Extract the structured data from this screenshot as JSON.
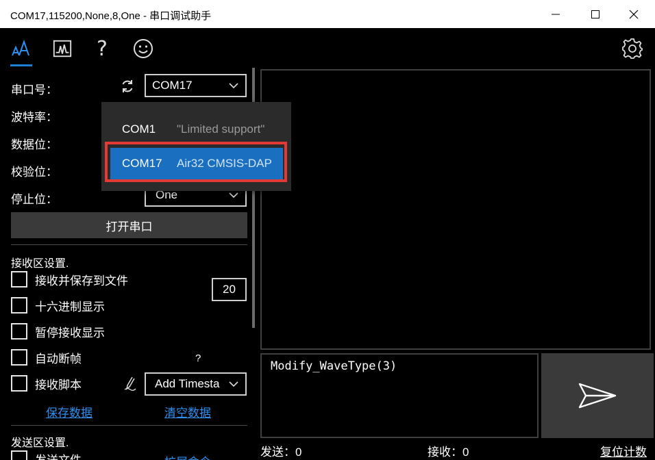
{
  "window": {
    "title": "COM17,115200,None,8,One - 串口调试助手"
  },
  "toolbar": {
    "icons": [
      "text-mode-icon",
      "chart-icon",
      "help-icon",
      "smiley-icon",
      "settings-icon"
    ],
    "help_glyph": "?"
  },
  "serial": {
    "port_label": "串口号：",
    "port_value": "COM17",
    "baud_label": "波特率：",
    "databits_label": "数据位：",
    "parity_label": "校验位：",
    "stopbits_label": "停止位：",
    "stopbits_value": "One",
    "open_button": "打开串口"
  },
  "port_dropdown": {
    "options": [
      {
        "name": "COM1",
        "desc": "\"Limited support\""
      },
      {
        "name": "COM17",
        "desc": "Air32 CMSIS-DAP",
        "selected": true
      }
    ]
  },
  "receive_settings": {
    "title": "接收区设置.",
    "save_to_file": "接收并保存到文件",
    "hex_display": "十六进制显示",
    "pause_display": "暂停接收显示",
    "auto_frame": "自动断帧",
    "frame_help": "?",
    "frame_value": "20",
    "script": "接收脚本",
    "script_option": "Add Timesta",
    "save_data_link": "保存数据",
    "clear_data_link": "清空数据"
  },
  "send_settings": {
    "title": "发送区设置.",
    "send_file": "发送文件",
    "extend_cmd": "扩展命令"
  },
  "send_area": {
    "text": "Modify_WaveType(3)"
  },
  "status": {
    "sent_label": "发送：",
    "sent_value": "0",
    "recv_label": "接收：",
    "recv_value": "0",
    "reset_link": "复位计数"
  },
  "colors": {
    "accent": "#1e7fd8",
    "selected": "#1a6fc0",
    "highlight": "#e53935",
    "link": "#2d8ff0"
  }
}
